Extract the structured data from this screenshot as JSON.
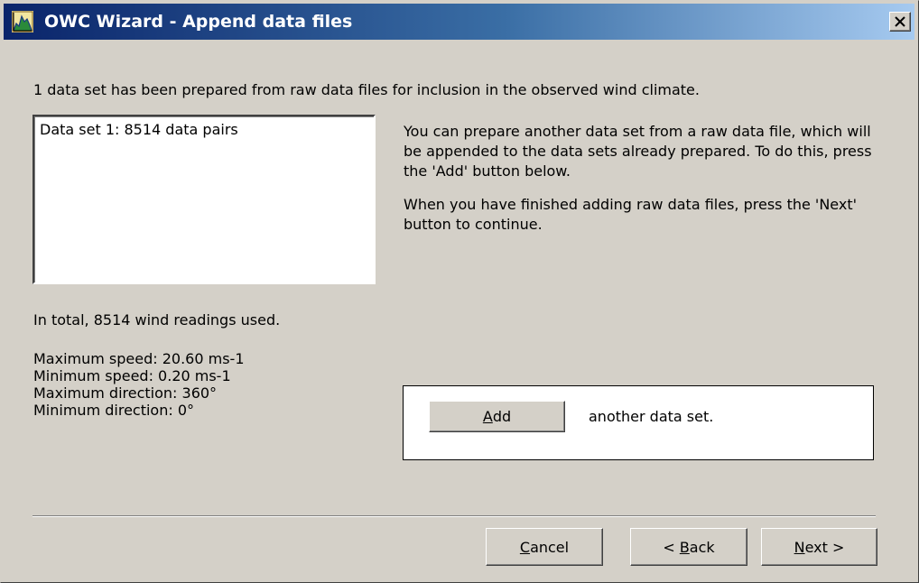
{
  "window": {
    "title": "OWC Wizard - Append data files",
    "icon": "owc-chart-icon",
    "close_icon": "close-icon"
  },
  "intro": "1 data set has been prepared from raw data files for inclusion in the observed wind climate.",
  "datasets": {
    "items": [
      "Data set 1: 8514 data pairs"
    ]
  },
  "instructions": {
    "paragraph1": "You can prepare another data set from a raw data file, which will be appended to the data sets already prepared. To do this, press the 'Add' button below.",
    "paragraph2": "When you have finished adding raw data files, press the 'Next' button to continue."
  },
  "total": "In total, 8514 wind readings used.",
  "stats": {
    "max_speed": "Maximum speed:  20.60 ms-1",
    "min_speed": "Minimum speed:  0.20 ms-1",
    "max_direction": "Maximum direction:  360°",
    "min_direction": "Minimum direction:  0°"
  },
  "add_panel": {
    "button_mnemonic": "A",
    "button_rest": "dd",
    "label": "another data set."
  },
  "buttons": {
    "cancel_mnemonic": "C",
    "cancel_rest": "ancel",
    "back_prefix": "< ",
    "back_mnemonic": "B",
    "back_rest": "ack",
    "next_mnemonic": "N",
    "next_rest": "ext >"
  }
}
